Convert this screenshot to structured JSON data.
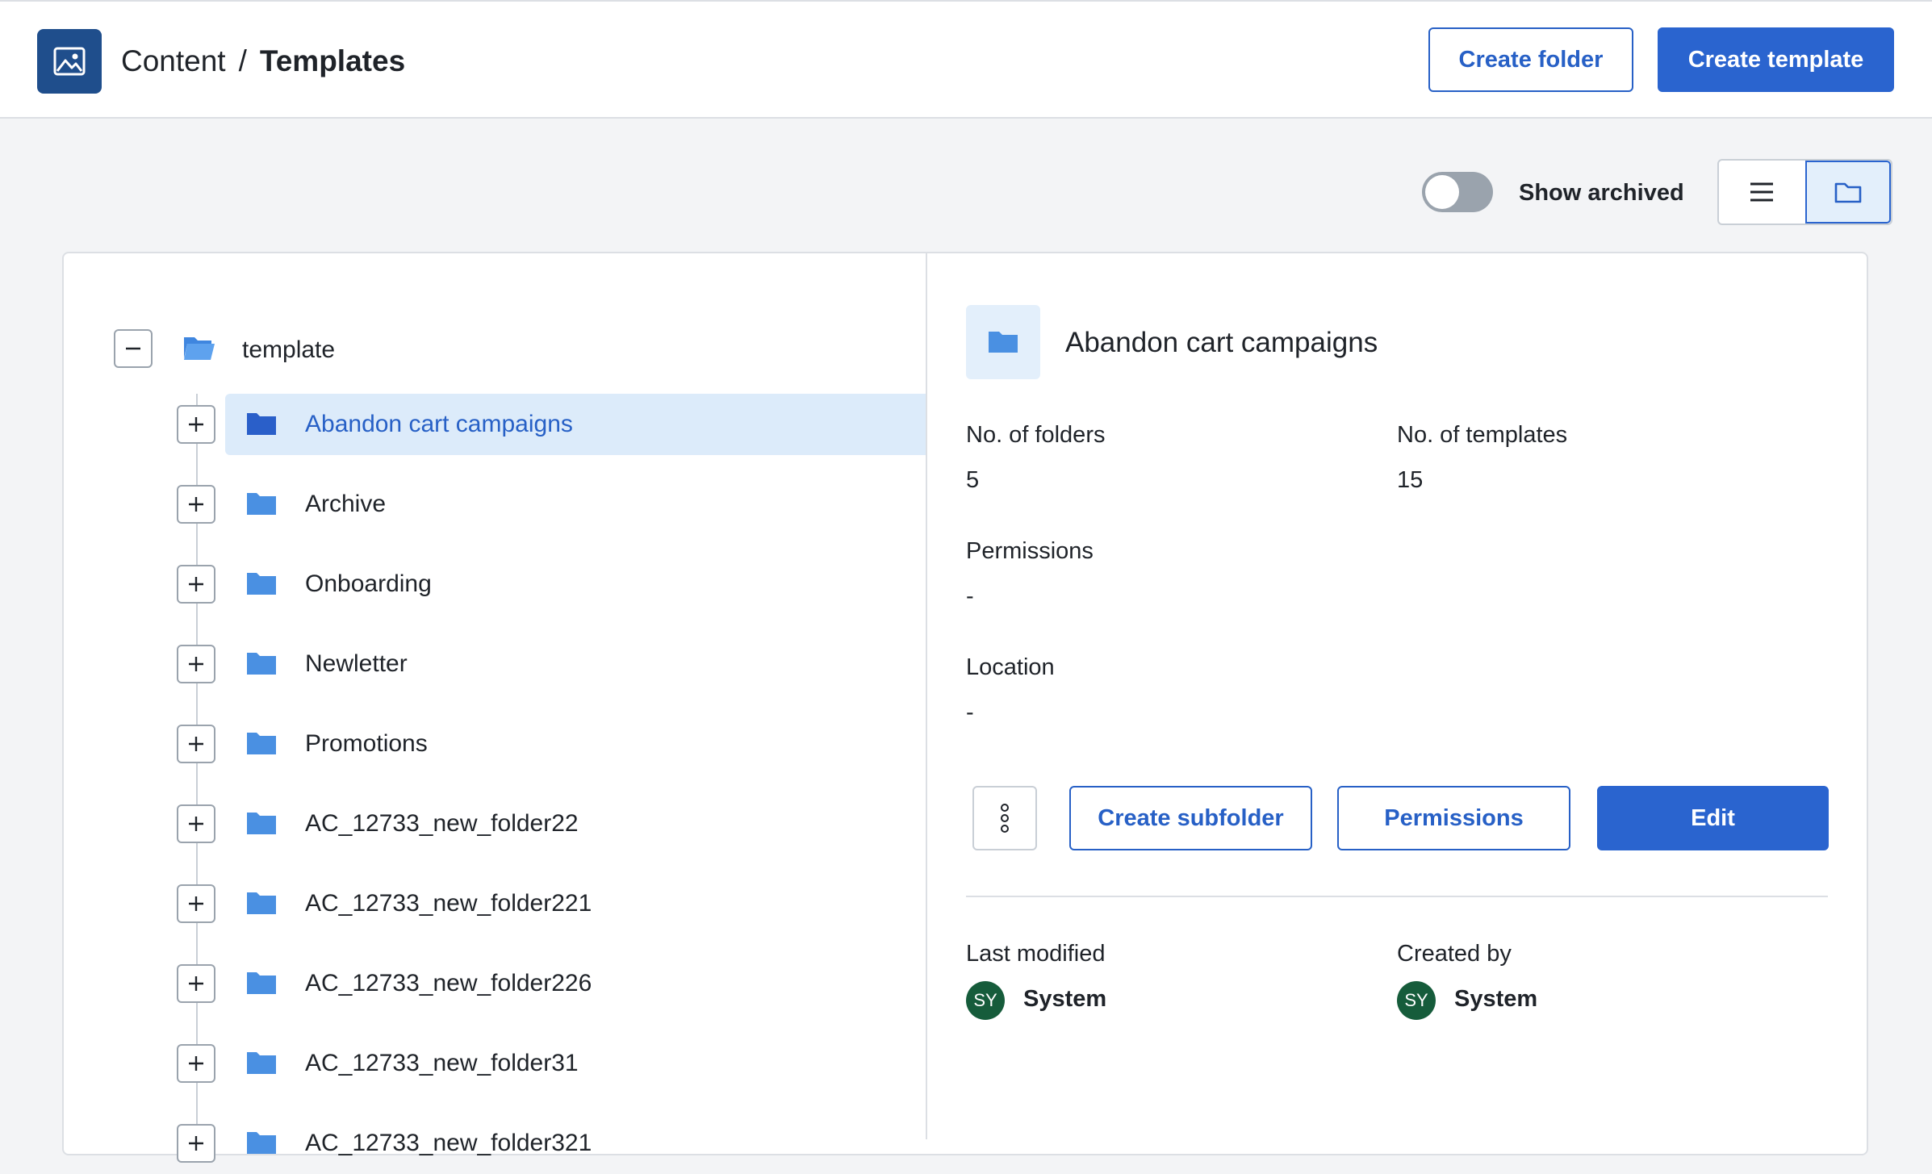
{
  "header": {
    "breadcrumb_root": "Content",
    "breadcrumb_separator": "/",
    "breadcrumb_current": "Templates",
    "create_folder_label": "Create folder",
    "create_template_label": "Create template",
    "app_icon": "image-icon"
  },
  "toolbar": {
    "show_archived_label": "Show archived",
    "show_archived_on": false,
    "view_modes": [
      "list-icon",
      "folder-icon"
    ],
    "active_view": "folder-icon"
  },
  "tree": {
    "root_label": "template",
    "items": [
      {
        "label": "Abandon cart campaigns",
        "selected": true
      },
      {
        "label": "Archive"
      },
      {
        "label": "Onboarding"
      },
      {
        "label": "Newletter"
      },
      {
        "label": "Promotions"
      },
      {
        "label": "AC_12733_new_folder22"
      },
      {
        "label": "AC_12733_new_folder221"
      },
      {
        "label": "AC_12733_new_folder226"
      },
      {
        "label": "AC_12733_new_folder31"
      },
      {
        "label": "AC_12733_new_folder321"
      }
    ]
  },
  "details": {
    "title": "Abandon cart campaigns",
    "folders_label": "No. of folders",
    "folders_value": "5",
    "templates_label": "No. of templates",
    "templates_value": "15",
    "permissions_label": "Permissions",
    "permissions_value": "-",
    "location_label": "Location",
    "location_value": "-",
    "create_subfolder_label": "Create subfolder",
    "permissions_button_label": "Permissions",
    "edit_label": "Edit",
    "last_modified_label": "Last modified",
    "last_modified_initials": "SY",
    "last_modified_user": "System",
    "created_by_label": "Created by",
    "created_by_initials": "SY",
    "created_by_user": "System"
  },
  "colors": {
    "primary": "#2a64cf",
    "folder": "#4a90e2",
    "selected_row": "#dcebfa",
    "avatar": "#165c3b"
  }
}
